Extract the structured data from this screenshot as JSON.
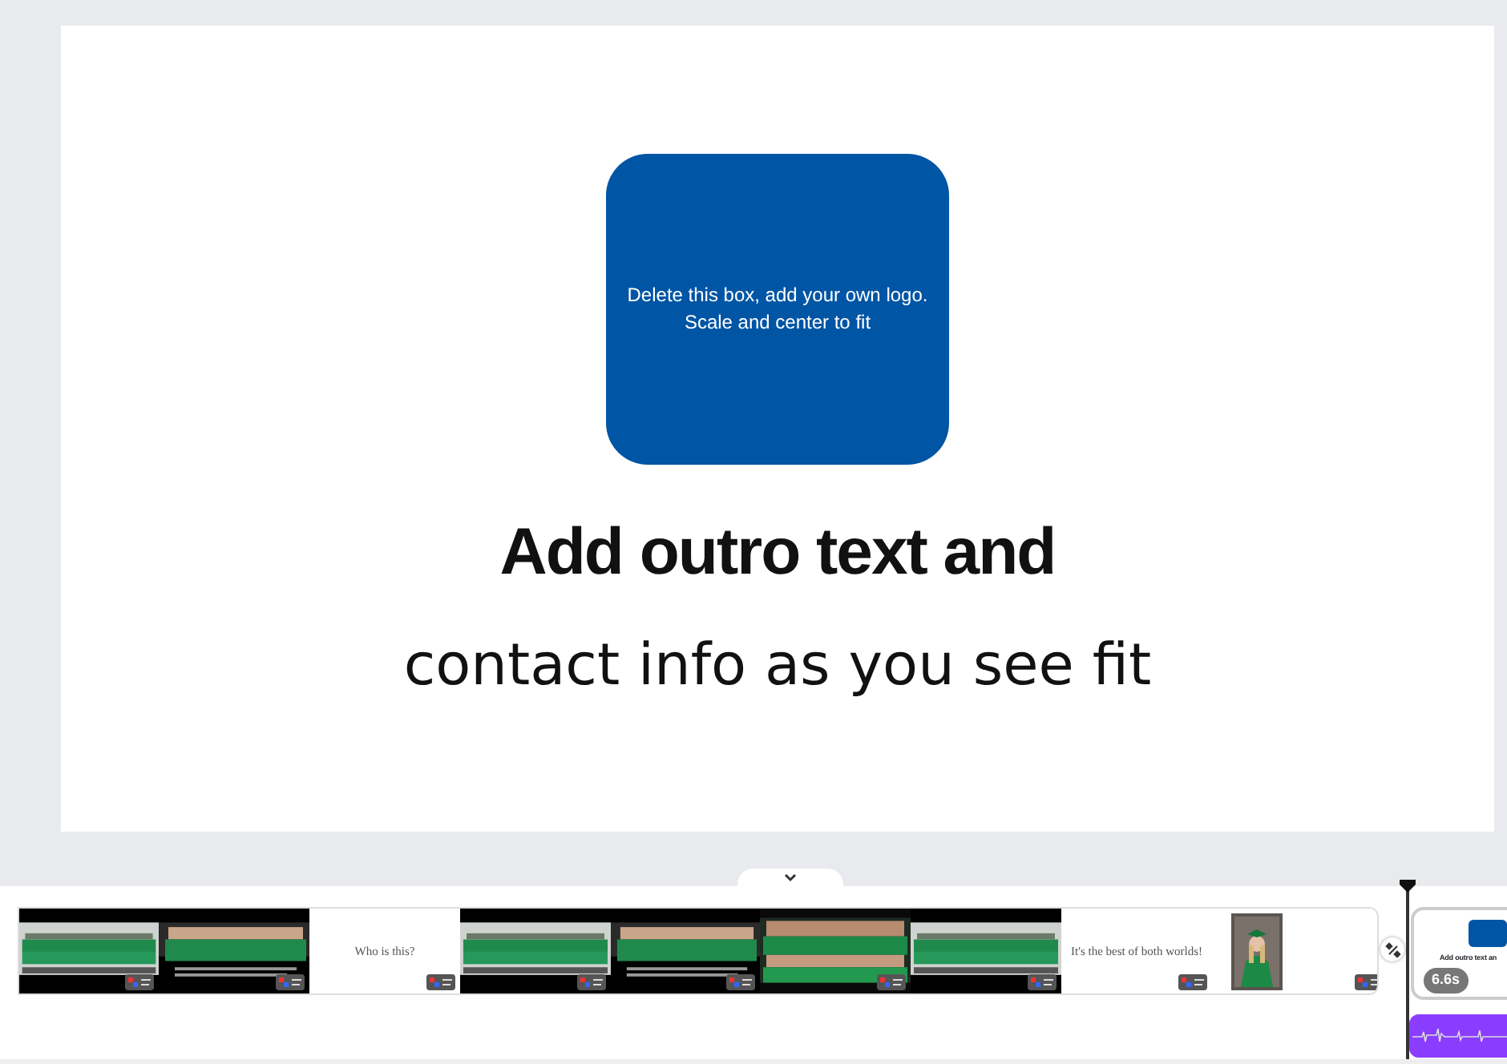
{
  "slide": {
    "logo_box": {
      "lines": [
        "Delete this box, add your own logo.",
        "Scale and center to fit"
      ]
    },
    "heading": "Add outro text and",
    "subheading": "contact info as you see fit"
  },
  "timeline": {
    "clips": [
      {
        "kind": "picture"
      },
      {
        "kind": "picture"
      },
      {
        "kind": "text",
        "text": "Who is this?"
      },
      {
        "kind": "picture"
      },
      {
        "kind": "picture"
      },
      {
        "kind": "picture"
      },
      {
        "kind": "picture"
      },
      {
        "kind": "text",
        "text": "It's the best of both worlds!"
      },
      {
        "kind": "portrait"
      }
    ],
    "outro_clip": {
      "title": "Add outro text an",
      "duration": "6.6s"
    }
  }
}
